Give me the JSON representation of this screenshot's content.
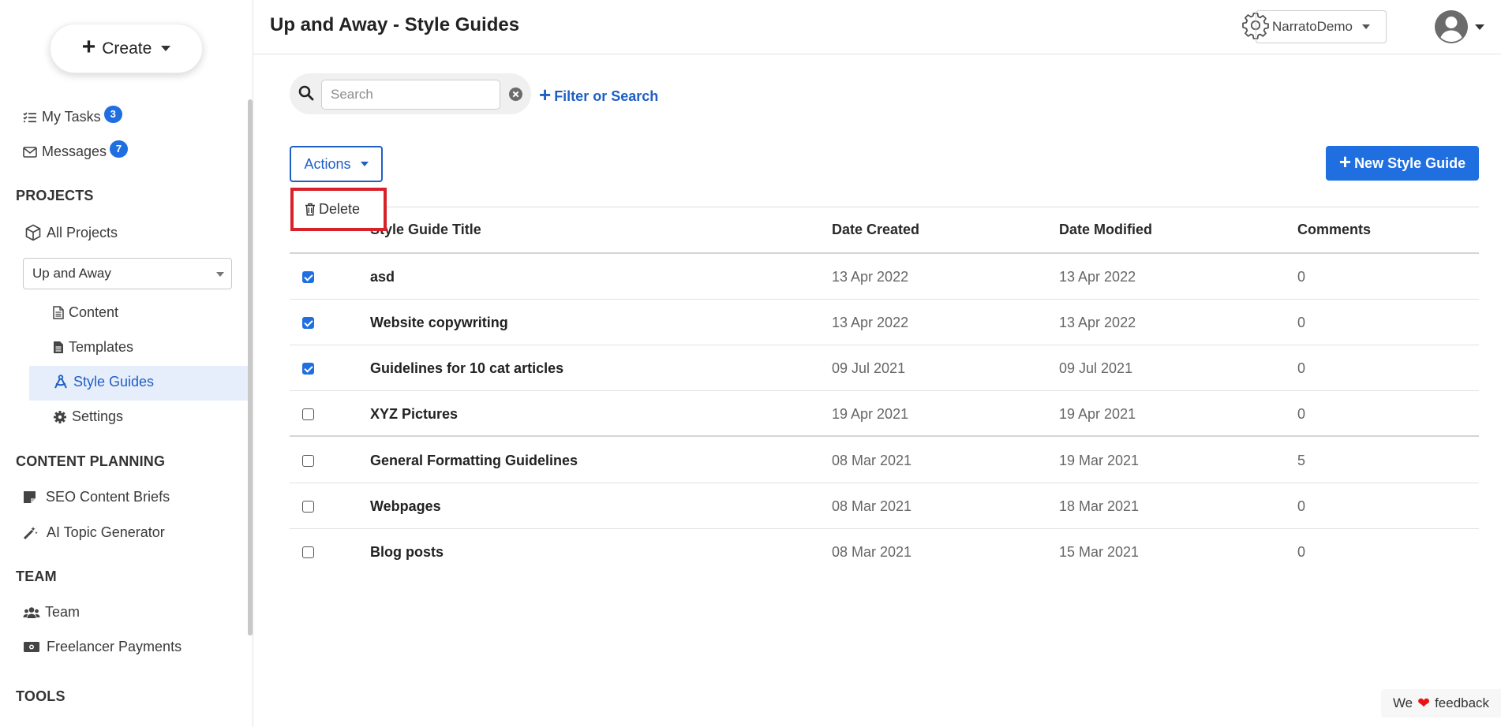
{
  "app": {
    "page_title": "Up and Away - Style Guides",
    "account_name": "NarratoDemo",
    "feedback": {
      "prefix": "We",
      "suffix": "feedback"
    }
  },
  "sidebar": {
    "create_label": "Create",
    "my_tasks": {
      "label": "My Tasks",
      "count": "3"
    },
    "messages": {
      "label": "Messages",
      "count": "7"
    },
    "projects_title": "PROJECTS",
    "all_projects": "All Projects",
    "project_select": "Up and Away",
    "project_items": {
      "content": "Content",
      "templates": "Templates",
      "style_guides": "Style Guides",
      "settings": "Settings"
    },
    "content_planning_title": "CONTENT PLANNING",
    "seo_briefs": "SEO Content Briefs",
    "ai_topic": "AI Topic Generator",
    "team_title": "TEAM",
    "team": "Team",
    "freelancer_payments": "Freelancer Payments",
    "tools_title": "TOOLS"
  },
  "toolbar": {
    "search_placeholder": "Search",
    "filter_label": "Filter or Search",
    "actions_label": "Actions",
    "delete_label": "Delete",
    "new_label": "New Style Guide"
  },
  "table": {
    "headers": {
      "title": "Style Guide Title",
      "created": "Date Created",
      "modified": "Date Modified",
      "comments": "Comments"
    },
    "rows": [
      {
        "checked": true,
        "title": "asd",
        "created": "13 Apr 2022",
        "modified": "13 Apr 2022",
        "comments": "0"
      },
      {
        "checked": true,
        "title": "Website copywriting",
        "created": "13 Apr 2022",
        "modified": "13 Apr 2022",
        "comments": "0"
      },
      {
        "checked": true,
        "title": "Guidelines for 10 cat articles",
        "created": "09 Jul 2021",
        "modified": "09 Jul 2021",
        "comments": "0"
      },
      {
        "checked": false,
        "title": "XYZ Pictures",
        "created": "19 Apr 2021",
        "modified": "19 Apr 2021",
        "comments": "0"
      },
      {
        "checked": false,
        "title": "General Formatting Guidelines",
        "created": "08 Mar 2021",
        "modified": "19 Mar 2021",
        "comments": "5"
      },
      {
        "checked": false,
        "title": "Webpages",
        "created": "08 Mar 2021",
        "modified": "18 Mar 2021",
        "comments": "0"
      },
      {
        "checked": false,
        "title": "Blog posts",
        "created": "08 Mar 2021",
        "modified": "15 Mar 2021",
        "comments": "0"
      }
    ]
  },
  "colors": {
    "accent": "#1f6fe0",
    "link": "#1f5fc4",
    "highlight_border": "#d8212b",
    "active_nav_bg": "#e7eefb"
  }
}
